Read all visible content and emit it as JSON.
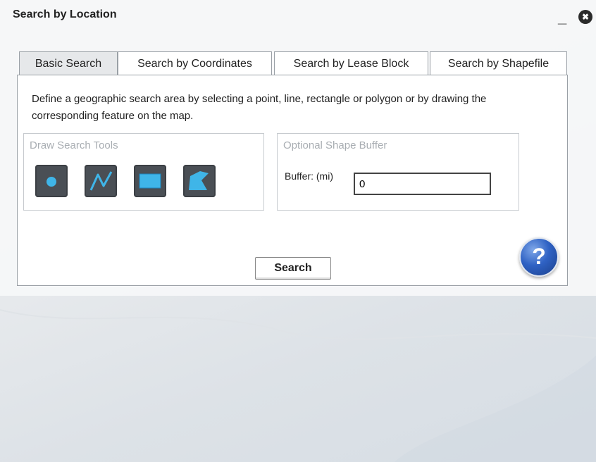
{
  "window": {
    "title": "Search by Location",
    "minimize_label": "_",
    "close_label": "✖"
  },
  "tabs": [
    {
      "label": "Basic Search",
      "active": true
    },
    {
      "label": "Search by Coordinates",
      "active": false
    },
    {
      "label": "Search by Lease Block",
      "active": false
    },
    {
      "label": "Search by Shapefile",
      "active": false
    }
  ],
  "basic_search": {
    "description": "Define a geographic search area by selecting a point, line, rectangle or polygon or by drawing the corresponding feature on the map.",
    "draw_tools": {
      "legend": "Draw Search Tools",
      "tools": [
        {
          "icon": "point-icon"
        },
        {
          "icon": "line-icon"
        },
        {
          "icon": "rectangle-icon"
        },
        {
          "icon": "polygon-icon"
        }
      ]
    },
    "buffer": {
      "legend": "Optional Shape Buffer",
      "label": "Buffer: (mi)",
      "value": "0"
    },
    "search_label": "Search",
    "help_label": "?"
  },
  "colors": {
    "tool_bg": "#4a4f55",
    "tool_glyph": "#3fb5e8",
    "help_blue": "#2f62c4"
  }
}
